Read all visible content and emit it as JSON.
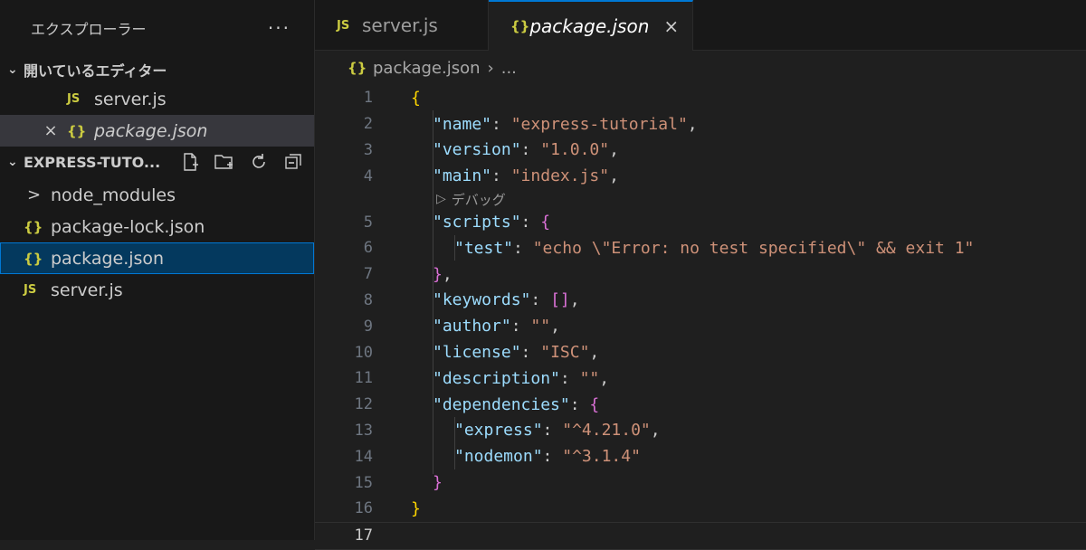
{
  "explorer": {
    "title": "エクスプローラー",
    "more_icon": "ellipsis-icon",
    "open_editors": {
      "header": "開いているエディター",
      "items": [
        {
          "icon": "JS",
          "label": "server.js"
        },
        {
          "icon": "{}",
          "label": "package.json",
          "close": "×"
        }
      ]
    },
    "project": {
      "header": "EXPRESS-TUTO...",
      "actions": [
        "new-file-icon",
        "new-folder-icon",
        "refresh-icon",
        "collapse-all-icon"
      ],
      "items": [
        {
          "icon": ">",
          "label": "node_modules"
        },
        {
          "icon": "{}",
          "label": "package-lock.json"
        },
        {
          "icon": "{}",
          "label": "package.json"
        },
        {
          "icon": "JS",
          "label": "server.js"
        }
      ]
    }
  },
  "tabs": [
    {
      "icon": "JS",
      "label": "server.js"
    },
    {
      "icon": "{}",
      "label": "package.json",
      "close": "×"
    }
  ],
  "breadcrumb": {
    "icon": "{}",
    "file": "package.json",
    "sep": "›",
    "more": "..."
  },
  "codelens": "デバッグ",
  "code": {
    "line_numbers": [
      "1",
      "2",
      "3",
      "4",
      "5",
      "6",
      "7",
      "8",
      "9",
      "10",
      "11",
      "12",
      "13",
      "14",
      "15",
      "16",
      "17"
    ],
    "l1": "{",
    "l2k": "\"name\"",
    "l2v": "\"express-tutorial\"",
    "l3k": "\"version\"",
    "l3v": "\"1.0.0\"",
    "l4k": "\"main\"",
    "l4v": "\"index.js\"",
    "l5k": "\"scripts\"",
    "l5b": "{",
    "l6k": "\"test\"",
    "l6v": "\"echo \\\"Error: no test specified\\\" && exit 1\"",
    "l7b": "}",
    "l8k": "\"keywords\"",
    "l8v": "[]",
    "l9k": "\"author\"",
    "l9v": "\"\"",
    "l10k": "\"license\"",
    "l10v": "\"ISC\"",
    "l11k": "\"description\"",
    "l11v": "\"\"",
    "l12k": "\"dependencies\"",
    "l12b": "{",
    "l13k": "\"express\"",
    "l13v": "\"^4.21.0\"",
    "l14k": "\"nodemon\"",
    "l14v": "\"^3.1.4\"",
    "l15b": "}",
    "l16": "}"
  }
}
